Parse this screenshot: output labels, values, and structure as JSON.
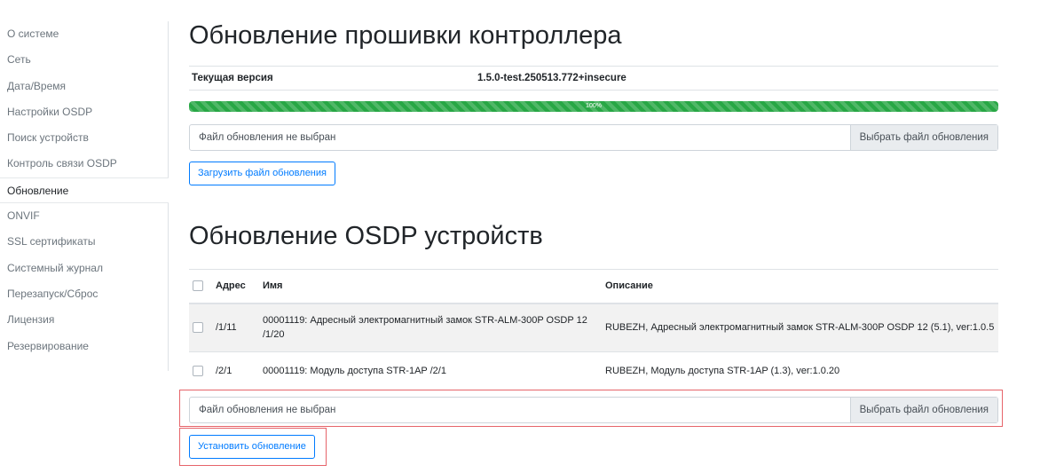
{
  "sidebar": {
    "items": [
      {
        "label": "О системе"
      },
      {
        "label": "Сеть"
      },
      {
        "label": "Дата/Время"
      },
      {
        "label": "Настройки OSDP"
      },
      {
        "label": "Поиск устройств"
      },
      {
        "label": "Контроль связи OSDP"
      },
      {
        "label": "Обновление",
        "active": true
      },
      {
        "label": "ONVIF"
      },
      {
        "label": "SSL сертификаты"
      },
      {
        "label": "Системный журнал"
      },
      {
        "label": "Перезапуск/Сброс"
      },
      {
        "label": "Лицензия"
      },
      {
        "label": "Резервирование"
      }
    ]
  },
  "firmware": {
    "title": "Обновление прошивки контроллера",
    "current_version_label": "Текущая версия",
    "current_version_value": "1.5.0-test.250513.772+insecure",
    "progress_percent": 100,
    "progress_label": "100%",
    "file_label": "Файл обновления не выбран",
    "file_button": "Выбрать файл обновления",
    "upload_button": "Загрузить файл обновления"
  },
  "osdp": {
    "title": "Обновление OSDP устройств",
    "columns": {
      "address": "Адрес",
      "name": "Имя",
      "description": "Описание"
    },
    "rows": [
      {
        "address": "/1/11",
        "name": "00001119: Адресный электромагнитный замок STR-ALM-300P OSDP 12 /1/20",
        "description": "RUBEZH, Адресный электромагнитный замок STR-ALM-300P OSDP 12 (5.1), ver:1.0.5"
      },
      {
        "address": "/2/1",
        "name": "00001119: Модуль доступа STR-1AP /2/1",
        "description": "RUBEZH, Модуль доступа STR-1AP (1.3), ver:1.0.20"
      }
    ],
    "file_label": "Файл обновления не выбран",
    "file_button": "Выбрать файл обновления",
    "install_button": "Установить обновление"
  },
  "colors": {
    "accent": "#007bff",
    "progress": "#28a745",
    "highlight_frame": "#e6646a"
  }
}
